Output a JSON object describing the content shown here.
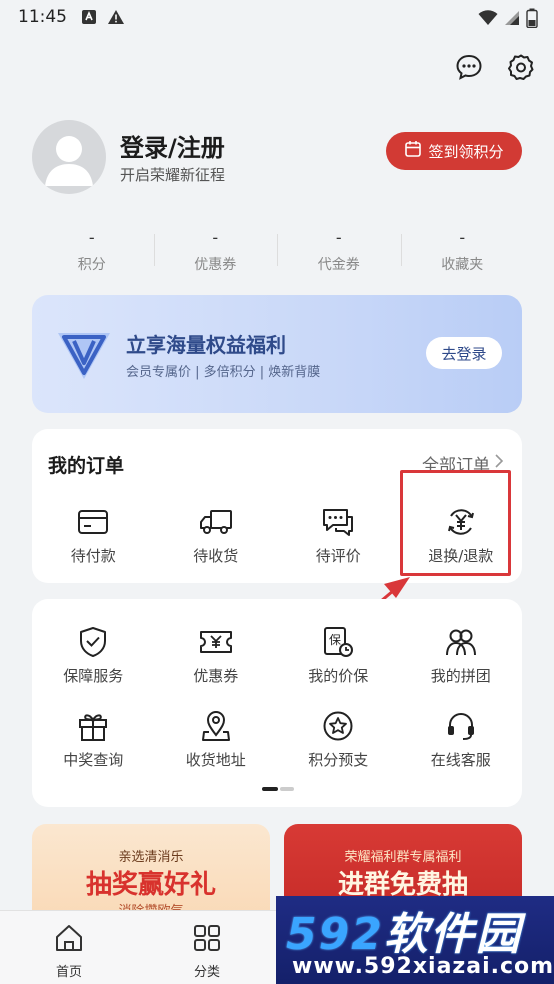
{
  "status_bar": {
    "time": "11:45"
  },
  "profile": {
    "title": "登录/注册",
    "subtitle": "开启荣耀新征程",
    "checkin_label": "签到领积分"
  },
  "stats": [
    {
      "value": "-",
      "label": "积分"
    },
    {
      "value": "-",
      "label": "优惠券"
    },
    {
      "value": "-",
      "label": "代金券"
    },
    {
      "value": "-",
      "label": "收藏夹"
    }
  ],
  "banner": {
    "title": "立享海量权益福利",
    "subtitle": "会员专属价 | 多倍积分 | 焕新背膜",
    "button": "去登录"
  },
  "orders": {
    "title": "我的订单",
    "view_all": "全部订单",
    "items": [
      {
        "label": "待付款",
        "icon": "card-icon"
      },
      {
        "label": "待收货",
        "icon": "truck-icon"
      },
      {
        "label": "待评价",
        "icon": "comment-icon"
      },
      {
        "label": "退换/退款",
        "icon": "refund-icon"
      }
    ]
  },
  "services": {
    "items": [
      {
        "label": "保障服务",
        "icon": "shield-icon"
      },
      {
        "label": "优惠券",
        "icon": "coupon-icon"
      },
      {
        "label": "我的价保",
        "icon": "price-protect-icon"
      },
      {
        "label": "我的拼团",
        "icon": "group-buy-icon"
      },
      {
        "label": "中奖查询",
        "icon": "gift-icon"
      },
      {
        "label": "收货地址",
        "icon": "location-icon"
      },
      {
        "label": "积分预支",
        "icon": "points-star-icon"
      },
      {
        "label": "在线客服",
        "icon": "headset-icon"
      }
    ]
  },
  "promos": [
    {
      "subtitle": "亲选清消乐",
      "title": "抽奖赢好礼",
      "tag": "消除攒欧气"
    },
    {
      "subtitle": "荣耀福利群专属福利",
      "title": "进群免费抽"
    }
  ],
  "bottom_nav": [
    {
      "label": "首页",
      "icon": "home-icon"
    },
    {
      "label": "分类",
      "icon": "grid-icon"
    }
  ],
  "watermark": {
    "brand_num": "592",
    "brand_text": "软件园",
    "url": "www.592xiazai.com"
  },
  "colors": {
    "accent_red": "#d23a34",
    "banner_blue": "#c9d8f8",
    "highlight_red": "#d9373a"
  }
}
